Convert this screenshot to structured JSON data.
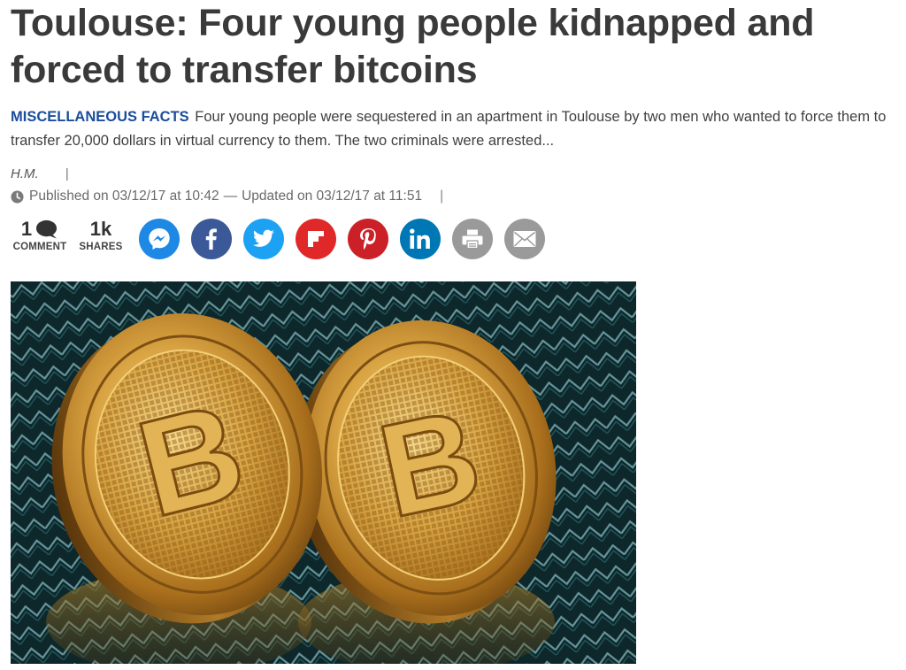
{
  "article": {
    "title": "Toulouse: Four young people kidnapped and forced to transfer bitcoins",
    "kicker": "MISCELLANEOUS FACTS",
    "lead": "Four young people were sequestered in an apartment in Toulouse by two men who wanted to force them to transfer 20,000 dollars in virtual currency to them. The two criminals were arrested...",
    "author": "H.M.",
    "author_separator": "|",
    "published": "Published on 03/12/17 at 10:42",
    "dash": "—",
    "updated": "Updated on 03/12/17 at 11:51",
    "date_separator": "|"
  },
  "share_bar": {
    "comments": {
      "count": "1",
      "label": "COMMENT"
    },
    "shares": {
      "count": "1k",
      "label": "SHARES"
    },
    "buttons": [
      {
        "network": "messenger",
        "icon": "messenger-icon",
        "color": "#1e88e5"
      },
      {
        "network": "facebook",
        "icon": "facebook-icon",
        "color": "#3b5998"
      },
      {
        "network": "twitter",
        "icon": "twitter-icon",
        "color": "#1da1f2"
      },
      {
        "network": "flipboard",
        "icon": "flipboard-icon",
        "color": "#e12828"
      },
      {
        "network": "pinterest",
        "icon": "pinterest-icon",
        "color": "#cb2027"
      },
      {
        "network": "linkedin",
        "icon": "linkedin-icon",
        "color": "#0077b5"
      },
      {
        "network": "print",
        "icon": "printer-icon",
        "color": "#9a9a9a"
      },
      {
        "network": "email",
        "icon": "envelope-icon",
        "color": "#9a9a9a"
      }
    ]
  },
  "colors": {
    "kicker": "#1b4d9b",
    "title": "#3a3a3a",
    "photo_background": "#0e2a2c",
    "coin_gold": "#c9962e"
  },
  "image": {
    "subject": "Two gold bitcoin coins standing on a patterned surface",
    "coin_symbol": "B"
  }
}
